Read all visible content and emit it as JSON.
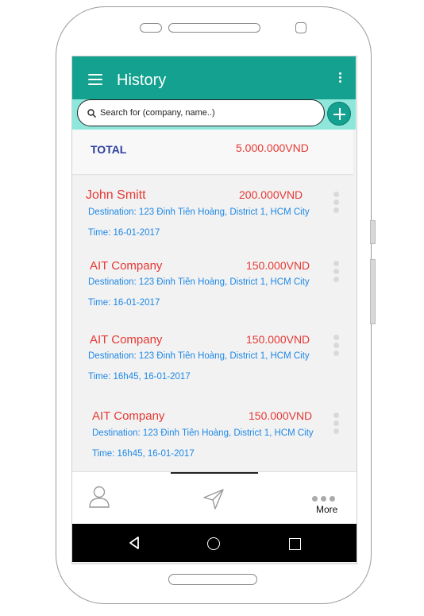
{
  "app": {
    "title": "History"
  },
  "search": {
    "placeholder": "Search for (company, name..)"
  },
  "total": {
    "label": "TOTAL",
    "value": "5.000.000VND"
  },
  "transactions": [
    {
      "name": "John Smitt",
      "amount": "200.000VND",
      "destination": "Destination: 123 Đinh Tiên Hoàng, District 1, HCM City",
      "time": "Time: 16-01-2017"
    },
    {
      "name": "AIT Company",
      "amount": "150.000VND",
      "destination": "Destination: 123 Đinh Tiên Hoàng, District 1, HCM City",
      "time": "Time: 16-01-2017"
    },
    {
      "name": "AIT Company",
      "amount": "150.000VND",
      "destination": "Destination: 123 Đinh Tiên Hoàng, District 1, HCM City",
      "time": "Time: 16h45, 16-01-2017"
    },
    {
      "name": "AIT Company",
      "amount": "150.000VND",
      "destination": "Destination: 123 Đinh Tiên Hoàng, District 1, HCM City",
      "time": "Time: 16h45, 16-01-2017"
    }
  ],
  "bottom_nav": {
    "more_label": "More"
  },
  "icons": [
    "menu-icon",
    "kebab-icon",
    "search-icon",
    "plus-icon",
    "more-vert-icon",
    "user-icon",
    "send-icon",
    "more-horiz-icon",
    "back-icon",
    "home-icon",
    "recent-apps-icon"
  ],
  "colors": {
    "primary": "#14a18f",
    "search_strip": "#8fe7dc",
    "amount": "#e53935",
    "detail": "#1e88e5",
    "total_label": "#2c3fa0"
  }
}
